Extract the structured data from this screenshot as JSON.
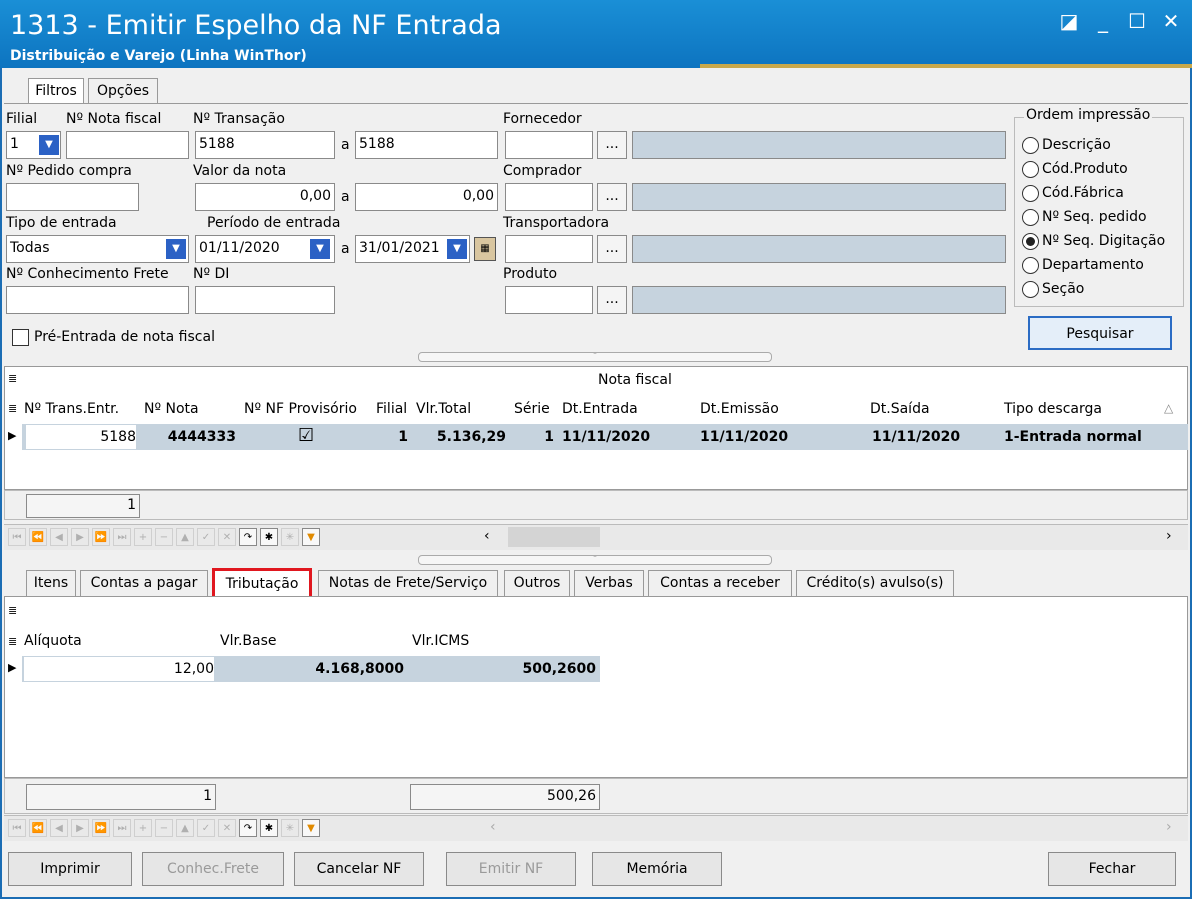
{
  "window": {
    "title": "1313 - Emitir Espelho da NF Entrada",
    "subtitle": "Distribuição e Varejo (Linha WinThor)",
    "controls": [
      "◪",
      "_",
      "☐",
      "✕"
    ]
  },
  "top_tabs": [
    "Filtros",
    "Opções"
  ],
  "filters": {
    "filial_label": "Filial",
    "filial_value": "1",
    "nota_fiscal_label": "Nº Nota fiscal",
    "nota_fiscal_value": "",
    "transacao_label": "Nº Transação",
    "transacao_from": "5188",
    "a_label": "a",
    "transacao_to": "5188",
    "fornecedor_label": "Fornecedor",
    "pedido_label": "Nº Pedido compra",
    "valor_label": "Valor da nota",
    "valor_from": "0,00",
    "valor_to": "0,00",
    "comprador_label": "Comprador",
    "tipo_entrada_label": "Tipo de entrada",
    "tipo_entrada_value": "Todas",
    "periodo_label": "Período de entrada",
    "periodo_from": "01/11/2020",
    "periodo_to": "31/01/2021",
    "transportadora_label": "Transportadora",
    "conhecimento_label": "Nº Conhecimento Frete",
    "di_label": "Nº DI",
    "produto_label": "Produto",
    "pre_entrada_label": "Pré-Entrada de nota fiscal",
    "dots": "..."
  },
  "ordem": {
    "title": "Ordem impressão",
    "options": [
      "Descrição",
      "Cód.Produto",
      "Cód.Fábrica",
      "Nº Seq. pedido",
      "Nº Seq. Digitação",
      "Departamento",
      "Seção"
    ],
    "selected": "Nº Seq. Digitação"
  },
  "pesquisar_label": "Pesquisar",
  "grid1": {
    "band": "Nota fiscal",
    "columns": [
      "Nº Trans.Entr.",
      "Nº Nota",
      "Nº NF Provisório",
      "Filial",
      "Vlr.Total",
      "Série",
      "Dt.Entrada",
      "Dt.Emissão",
      "Dt.Saída",
      "Tipo descarga"
    ],
    "row": {
      "trans": "5188",
      "nota": "4444333",
      "provisorio": "☑",
      "filial": "1",
      "total": "5.136,29",
      "serie": "1",
      "entrada": "11/11/2020",
      "emissao": "11/11/2020",
      "saida": "11/11/2020",
      "tipo": "1-Entrada normal"
    },
    "footer_count": "1"
  },
  "bottom_tabs": [
    "Itens",
    "Contas a pagar",
    "Tributação",
    "Notas de Frete/Serviço",
    "Outros",
    "Verbas",
    "Contas a receber",
    "Crédito(s) avulso(s)"
  ],
  "active_tab": "Tributação",
  "grid2": {
    "columns": [
      "Alíquota",
      "Vlr.Base",
      "Vlr.ICMS"
    ],
    "row": {
      "aliquota": "12,00",
      "base": "4.168,8000",
      "icms": "500,2600"
    },
    "footer_count": "1",
    "footer_total": "500,26"
  },
  "nav_symbols": [
    "⏮",
    "⏪",
    "◀",
    "▶",
    "⏩",
    "⏭",
    "+",
    "−",
    "▲",
    "✓",
    "✕",
    "↷",
    "✱",
    "✳",
    "▼"
  ],
  "buttons": {
    "imprimir": "Imprimir",
    "conhec_frete": "Conhec.Frete",
    "cancelar_nf": "Cancelar NF",
    "emitir_nf": "Emitir NF",
    "memoria": "Memória",
    "fechar": "Fechar"
  },
  "colors": {
    "titlebar": "#0d74c0",
    "highlight_box": "#e0171f",
    "readonly": "#c6d3de",
    "selected_row": "#c6d3de"
  }
}
